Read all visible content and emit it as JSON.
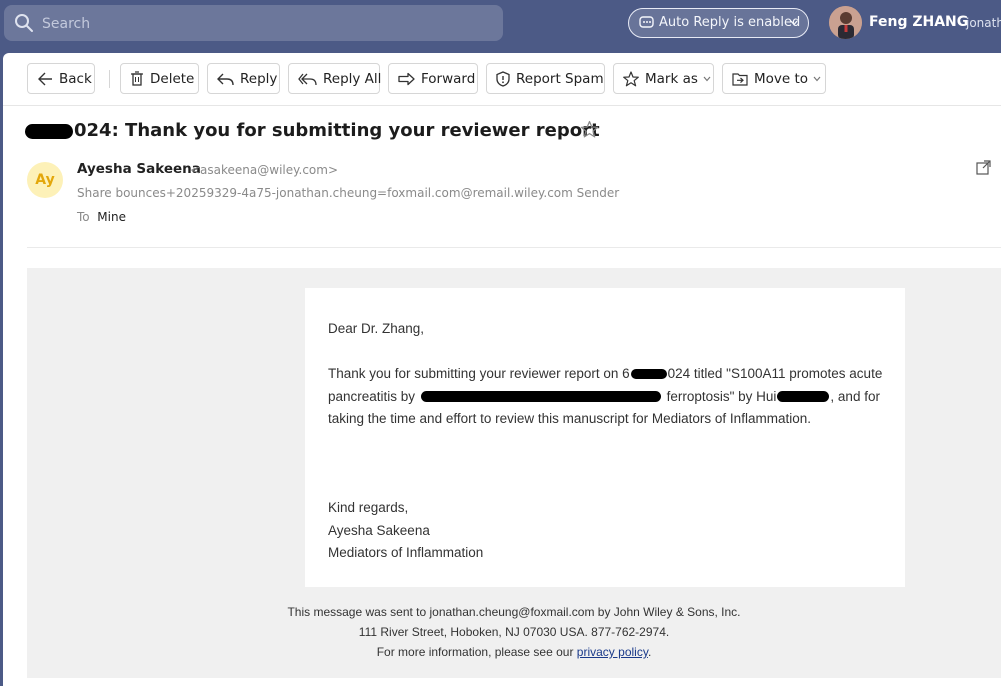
{
  "search": {
    "placeholder": "Search"
  },
  "auto_reply": {
    "label": "Auto Reply is enabled"
  },
  "user": {
    "name": "Feng ZHANG",
    "email_partial": "jonath"
  },
  "toolbar": {
    "back": "Back",
    "delete": "Delete",
    "reply": "Reply",
    "reply_all": "Reply All",
    "forward": "Forward",
    "report_spam": "Report Spam",
    "mark_as": "Mark as",
    "move_to": "Move to"
  },
  "message": {
    "subject_visible": "024: Thank you for submitting your reviewer report",
    "sender": {
      "initials": "Ay",
      "name": "Ayesha Sakeena",
      "email": "<asakeena@wiley.com>"
    },
    "share_label": "Share",
    "share_address": "bounces+20259329-4a75-jonathan.cheung=foxmail.com@remail.wiley.com",
    "share_suffix": "Sender",
    "to_label": "To",
    "to_value": "Mine"
  },
  "body": {
    "greeting": "Dear Dr. Zhang,",
    "p1_a": "Thank you for submitting your reviewer report on 6",
    "p1_b": "024 titled \"S100A11 promotes acute pancreatitis by",
    "p1_c": "ferroptosis\" by Hui",
    "p1_d": ", and for taking the time and effort to review this manuscript for Mediators of Inflammation.",
    "closing": "Kind regards,",
    "sig_name": "Ayesha Sakeena",
    "sig_org": "Mediators of Inflammation"
  },
  "footer": {
    "line1": "This message was sent to jonathan.cheung@foxmail.com by John Wiley & Sons, Inc.",
    "line2": "111 River Street, Hoboken, NJ 07030 USA. 877-762-2974.",
    "line3_prefix": "For more information, please see our ",
    "privacy_link": "privacy policy",
    "line3_suffix": "."
  }
}
